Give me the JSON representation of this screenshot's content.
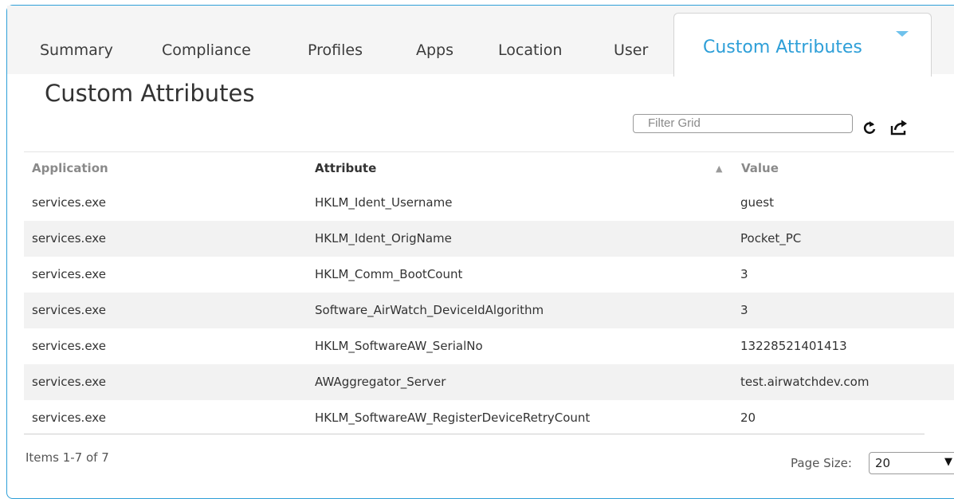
{
  "tabs": [
    {
      "label": "Summary"
    },
    {
      "label": "Compliance"
    },
    {
      "label": "Profiles"
    },
    {
      "label": "Apps"
    },
    {
      "label": "Location"
    },
    {
      "label": "User"
    }
  ],
  "active_tab": {
    "label": "Custom Attributes"
  },
  "page_title": "Custom Attributes",
  "filter": {
    "placeholder": "Filter Grid",
    "value": ""
  },
  "toolbar_icons": [
    "refresh-icon",
    "export-icon"
  ],
  "grid": {
    "columns": [
      {
        "label": "Application"
      },
      {
        "label": "Attribute",
        "sort_indicator": "▲"
      },
      {
        "label": "Value"
      }
    ],
    "rows": [
      {
        "application": "services.exe",
        "attribute": "HKLM_Ident_Username",
        "value": "guest"
      },
      {
        "application": "services.exe",
        "attribute": "HKLM_Ident_OrigName",
        "value": "Pocket_PC"
      },
      {
        "application": "services.exe",
        "attribute": "HKLM_Comm_BootCount",
        "value": "3"
      },
      {
        "application": "services.exe",
        "attribute": "Software_AirWatch_DeviceIdAlgorithm",
        "value": "3"
      },
      {
        "application": "services.exe",
        "attribute": "HKLM_SoftwareAW_SerialNo",
        "value": "13228521401413"
      },
      {
        "application": "services.exe",
        "attribute": "AWAggregator_Server",
        "value": "test.airwatchdev.com"
      },
      {
        "application": "services.exe",
        "attribute": "HKLM_SoftwareAW_RegisterDeviceRetryCount",
        "value": "20"
      }
    ]
  },
  "pager": {
    "items_text": "Items 1-7 of 7",
    "page_size_label": "Page Size:",
    "page_size_value": "20"
  },
  "colors": {
    "accent": "#2e9fd8",
    "row_alt": "#f2f2f2",
    "tabbar_bg": "#f5f5f5"
  }
}
